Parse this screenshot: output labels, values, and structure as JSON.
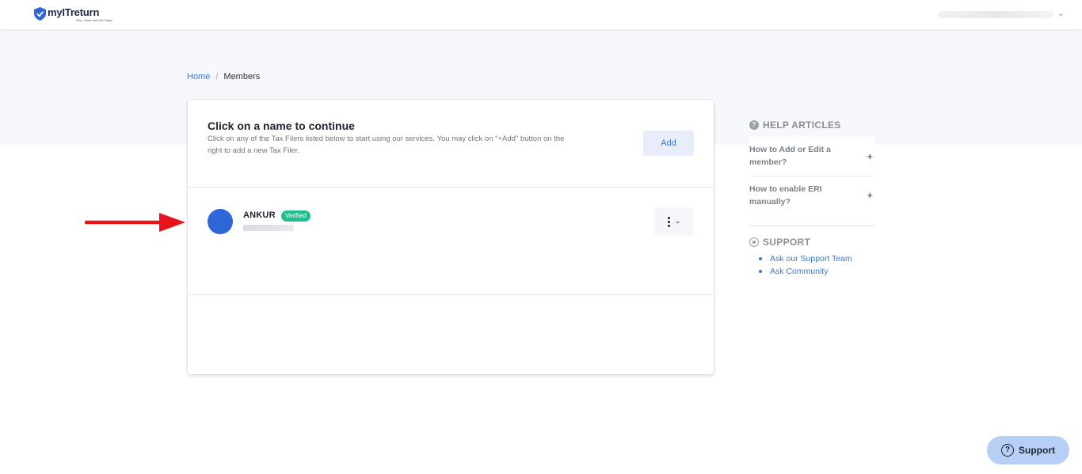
{
  "header": {
    "logo_name": "myITreturn",
    "logo_tagline": "Plan, Save and File Taxes",
    "user_menu_icon": "chevron-down-icon"
  },
  "breadcrumb": {
    "home": "Home",
    "separator": "/",
    "current": "Members"
  },
  "card": {
    "title": "Click on a name to continue",
    "description": "Click on any of the Tax Filers listed below to start using our services. You may click on \"+Add\" button on the right to add a new Tax Filer.",
    "add_label": "Add",
    "members": [
      {
        "name": "ANKUR",
        "badge": "Verified",
        "avatar_color": "#2f67d8"
      }
    ]
  },
  "help": {
    "heading": "HELP ARTICLES",
    "articles": [
      "How to Add or Edit a member?",
      "How to enable ERI manually?"
    ],
    "support_heading": "SUPPORT",
    "support_links": [
      "Ask our Support Team",
      "Ask Community"
    ]
  },
  "floating_support": {
    "label": "Support"
  },
  "colors": {
    "accent": "#3a78c9",
    "verified": "#1fbf8f",
    "annotation_arrow": "#e8141c"
  }
}
